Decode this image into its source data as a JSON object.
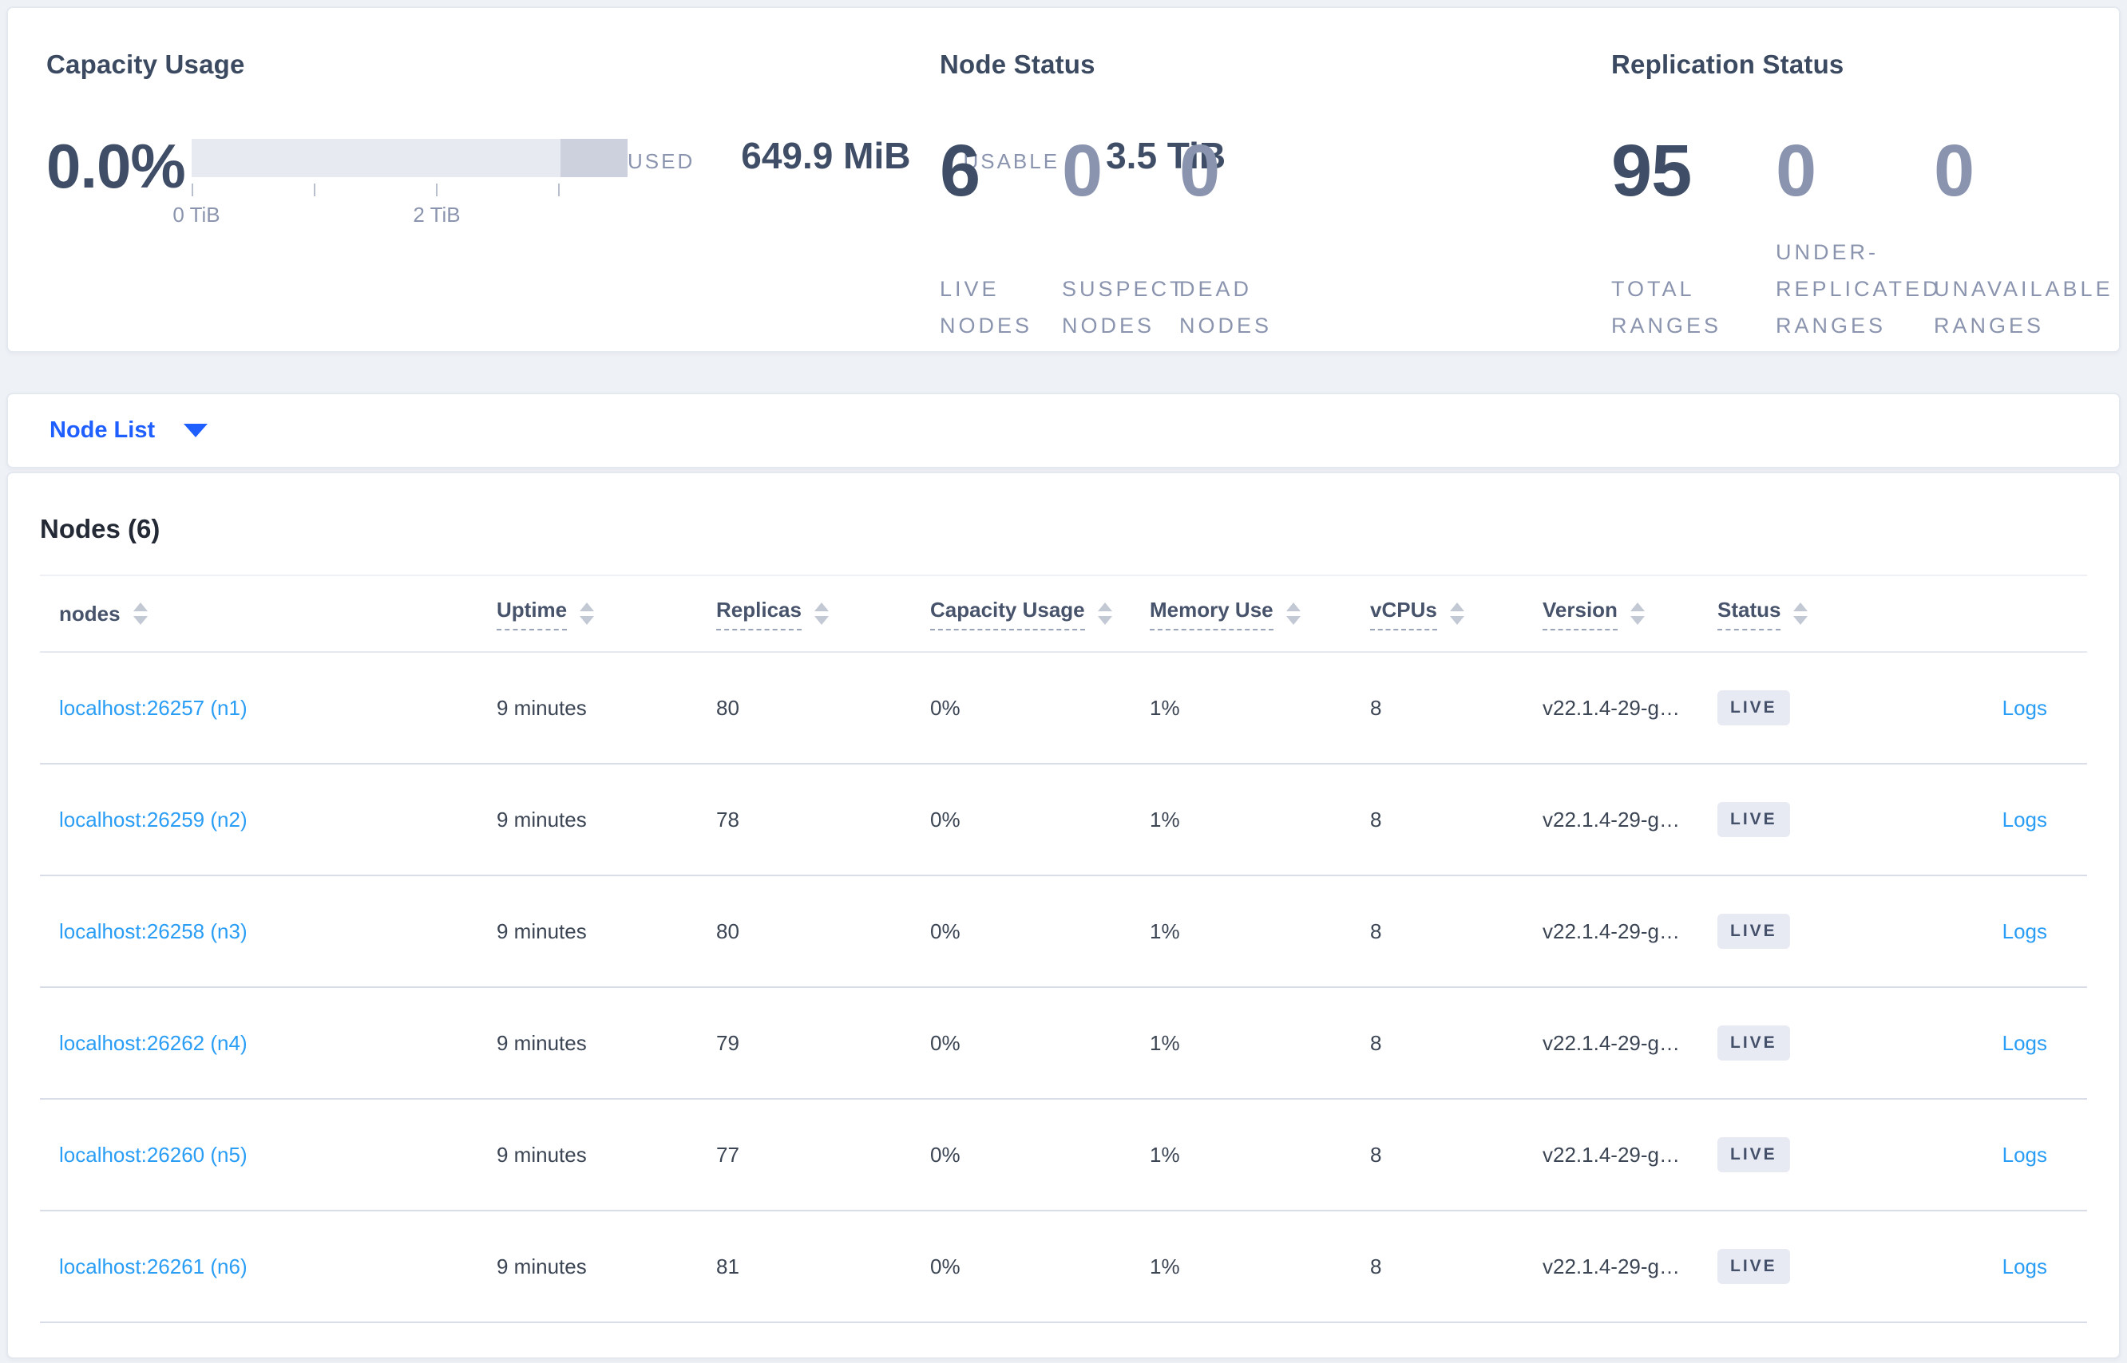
{
  "colors": {
    "accent_blue": "#1f5eff",
    "link_blue": "#2a9df5",
    "dark_text": "#3f4e66",
    "muted_text": "#8a94ae",
    "badge_bg": "#e7eaf2",
    "page_bg": "#eef1f6"
  },
  "capacity": {
    "title": "Capacity Usage",
    "percent": "0.0%",
    "tick_labels": [
      "0 TiB",
      "2 TiB"
    ],
    "used_label": "USED",
    "used_value": "649.9 MiB",
    "usable_label": "USABLE",
    "usable_value": "3.5 TiB"
  },
  "node_status": {
    "title": "Node Status",
    "stats": [
      {
        "value": "6",
        "label": "LIVE NODES"
      },
      {
        "value": "0",
        "label": "SUSPECT NODES"
      },
      {
        "value": "0",
        "label": "DEAD NODES"
      }
    ]
  },
  "replication": {
    "title": "Replication Status",
    "stats": [
      {
        "value": "95",
        "label": "TOTAL RANGES"
      },
      {
        "value": "0",
        "label": "UNDER-REPLICATED RANGES"
      },
      {
        "value": "0",
        "label": "UNAVAILABLE RANGES"
      }
    ]
  },
  "view_selector": {
    "label": "Node List"
  },
  "nodes_table": {
    "title": "Nodes (6)",
    "headers": {
      "nodes": "nodes",
      "uptime": "Uptime",
      "replicas": "Replicas",
      "capacity": "Capacity Usage",
      "memory": "Memory Use",
      "vcpus": "vCPUs",
      "version": "Version",
      "status": "Status"
    },
    "rows": [
      {
        "node": "localhost:26257 (n1)",
        "uptime": "9 minutes",
        "replicas": "80",
        "capacity": "0%",
        "memory": "1%",
        "vcpus": "8",
        "version": "v22.1.4-29-g…",
        "status": "LIVE",
        "logs": "Logs"
      },
      {
        "node": "localhost:26259 (n2)",
        "uptime": "9 minutes",
        "replicas": "78",
        "capacity": "0%",
        "memory": "1%",
        "vcpus": "8",
        "version": "v22.1.4-29-g…",
        "status": "LIVE",
        "logs": "Logs"
      },
      {
        "node": "localhost:26258 (n3)",
        "uptime": "9 minutes",
        "replicas": "80",
        "capacity": "0%",
        "memory": "1%",
        "vcpus": "8",
        "version": "v22.1.4-29-g…",
        "status": "LIVE",
        "logs": "Logs"
      },
      {
        "node": "localhost:26262 (n4)",
        "uptime": "9 minutes",
        "replicas": "79",
        "capacity": "0%",
        "memory": "1%",
        "vcpus": "8",
        "version": "v22.1.4-29-g…",
        "status": "LIVE",
        "logs": "Logs"
      },
      {
        "node": "localhost:26260 (n5)",
        "uptime": "9 minutes",
        "replicas": "77",
        "capacity": "0%",
        "memory": "1%",
        "vcpus": "8",
        "version": "v22.1.4-29-g…",
        "status": "LIVE",
        "logs": "Logs"
      },
      {
        "node": "localhost:26261 (n6)",
        "uptime": "9 minutes",
        "replicas": "81",
        "capacity": "0%",
        "memory": "1%",
        "vcpus": "8",
        "version": "v22.1.4-29-g…",
        "status": "LIVE",
        "logs": "Logs"
      }
    ]
  }
}
